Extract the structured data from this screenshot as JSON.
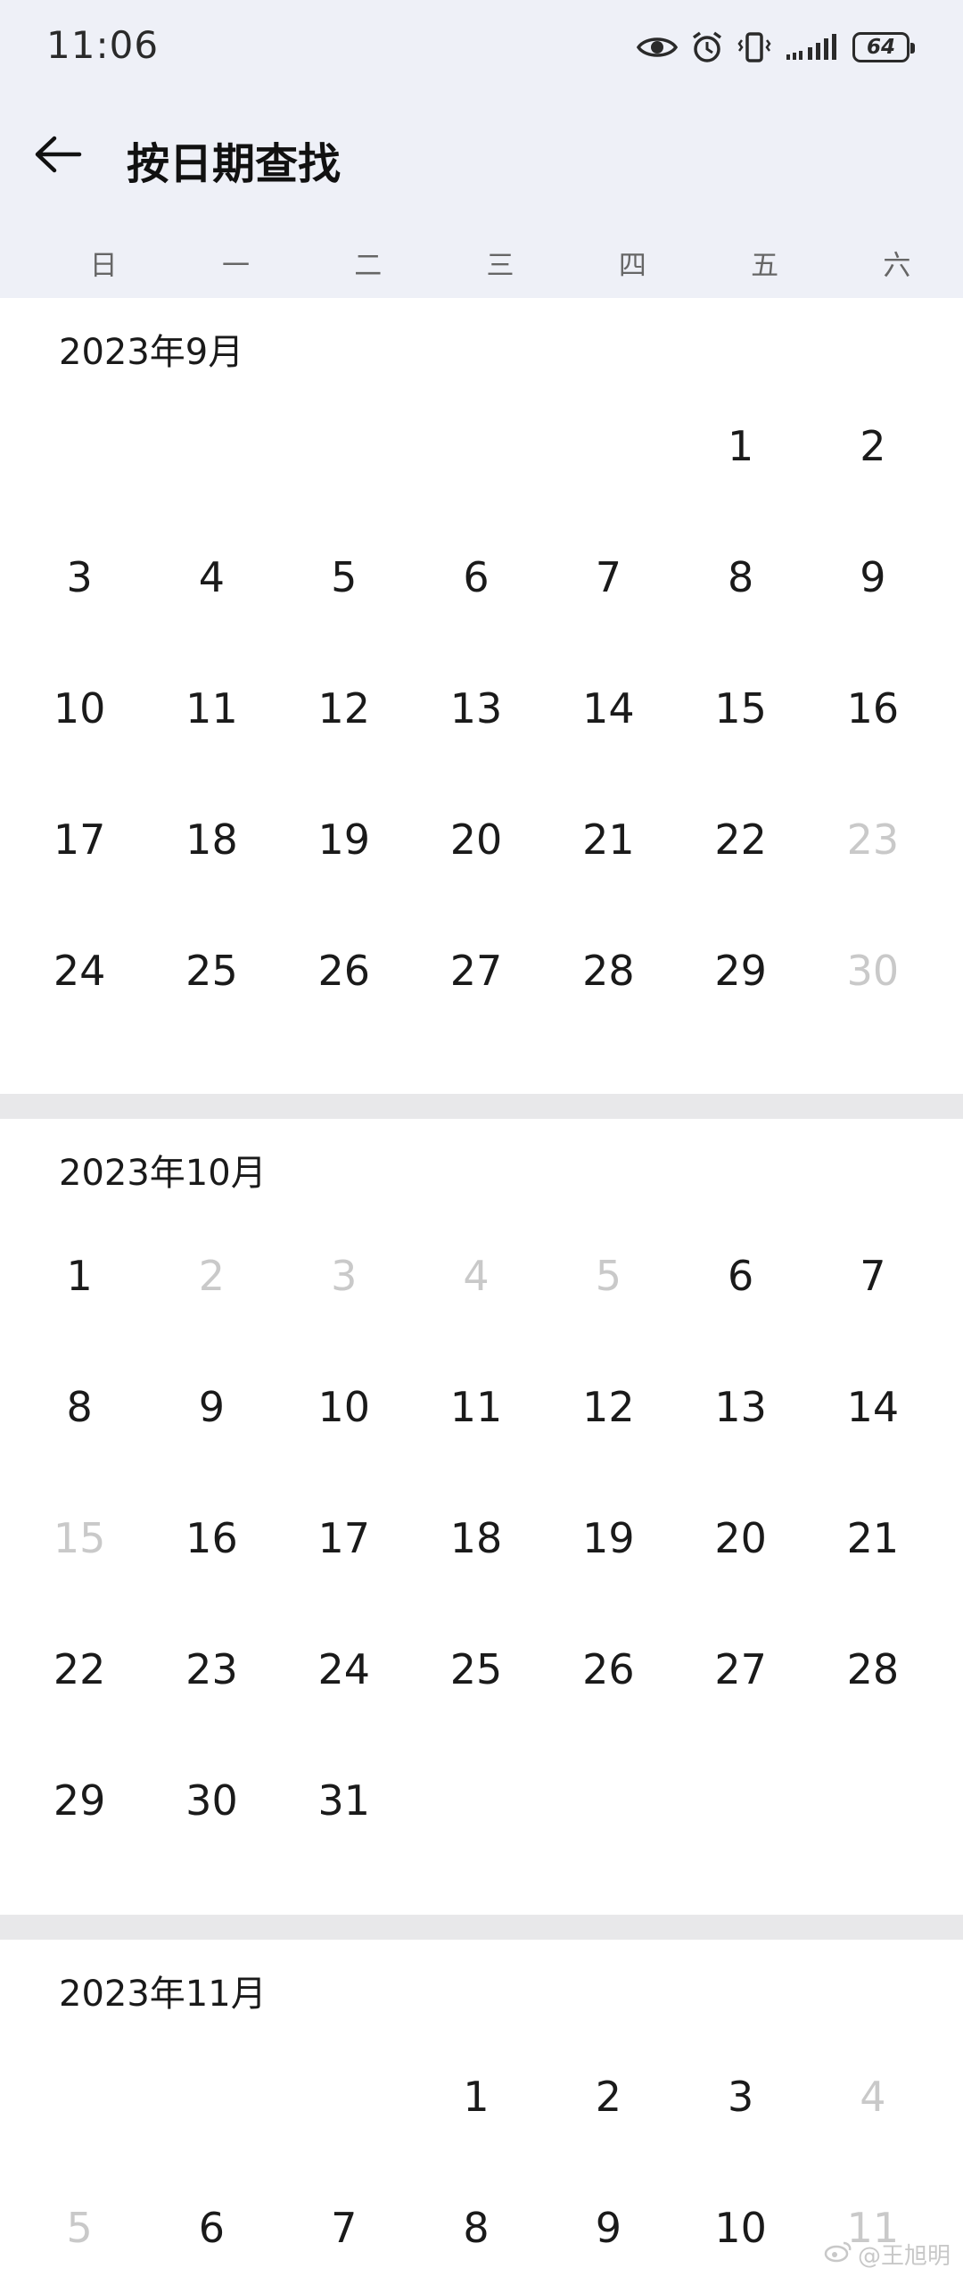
{
  "status_bar": {
    "time": "11:06",
    "battery": "64",
    "icons": [
      "eye-icon",
      "alarm-icon",
      "vibrate-icon",
      "signal-icon",
      "battery-icon"
    ]
  },
  "header": {
    "back_icon": "arrow-left-icon",
    "title": "按日期查找"
  },
  "weekdays": [
    "日",
    "一",
    "二",
    "三",
    "四",
    "五",
    "六"
  ],
  "months": [
    {
      "title": "2023年9月",
      "days": [
        {
          "d": "",
          "dis": false
        },
        {
          "d": "",
          "dis": false
        },
        {
          "d": "",
          "dis": false
        },
        {
          "d": "",
          "dis": false
        },
        {
          "d": "",
          "dis": false
        },
        {
          "d": "1",
          "dis": false
        },
        {
          "d": "2",
          "dis": false
        },
        {
          "d": "3",
          "dis": false
        },
        {
          "d": "4",
          "dis": false
        },
        {
          "d": "5",
          "dis": false
        },
        {
          "d": "6",
          "dis": false
        },
        {
          "d": "7",
          "dis": false
        },
        {
          "d": "8",
          "dis": false
        },
        {
          "d": "9",
          "dis": false
        },
        {
          "d": "10",
          "dis": false
        },
        {
          "d": "11",
          "dis": false
        },
        {
          "d": "12",
          "dis": false
        },
        {
          "d": "13",
          "dis": false
        },
        {
          "d": "14",
          "dis": false
        },
        {
          "d": "15",
          "dis": false
        },
        {
          "d": "16",
          "dis": false
        },
        {
          "d": "17",
          "dis": false
        },
        {
          "d": "18",
          "dis": false
        },
        {
          "d": "19",
          "dis": false
        },
        {
          "d": "20",
          "dis": false
        },
        {
          "d": "21",
          "dis": false
        },
        {
          "d": "22",
          "dis": false
        },
        {
          "d": "23",
          "dis": true
        },
        {
          "d": "24",
          "dis": false
        },
        {
          "d": "25",
          "dis": false
        },
        {
          "d": "26",
          "dis": false
        },
        {
          "d": "27",
          "dis": false
        },
        {
          "d": "28",
          "dis": false
        },
        {
          "d": "29",
          "dis": false
        },
        {
          "d": "30",
          "dis": true
        }
      ]
    },
    {
      "title": "2023年10月",
      "days": [
        {
          "d": "1",
          "dis": false
        },
        {
          "d": "2",
          "dis": true
        },
        {
          "d": "3",
          "dis": true
        },
        {
          "d": "4",
          "dis": true
        },
        {
          "d": "5",
          "dis": true
        },
        {
          "d": "6",
          "dis": false
        },
        {
          "d": "7",
          "dis": false
        },
        {
          "d": "8",
          "dis": false
        },
        {
          "d": "9",
          "dis": false
        },
        {
          "d": "10",
          "dis": false
        },
        {
          "d": "11",
          "dis": false
        },
        {
          "d": "12",
          "dis": false
        },
        {
          "d": "13",
          "dis": false
        },
        {
          "d": "14",
          "dis": false
        },
        {
          "d": "15",
          "dis": true
        },
        {
          "d": "16",
          "dis": false
        },
        {
          "d": "17",
          "dis": false
        },
        {
          "d": "18",
          "dis": false
        },
        {
          "d": "19",
          "dis": false
        },
        {
          "d": "20",
          "dis": false
        },
        {
          "d": "21",
          "dis": false
        },
        {
          "d": "22",
          "dis": false
        },
        {
          "d": "23",
          "dis": false
        },
        {
          "d": "24",
          "dis": false
        },
        {
          "d": "25",
          "dis": false
        },
        {
          "d": "26",
          "dis": false
        },
        {
          "d": "27",
          "dis": false
        },
        {
          "d": "28",
          "dis": false
        },
        {
          "d": "29",
          "dis": false
        },
        {
          "d": "30",
          "dis": false
        },
        {
          "d": "31",
          "dis": false
        }
      ]
    },
    {
      "title": "2023年11月",
      "days": [
        {
          "d": "",
          "dis": false
        },
        {
          "d": "",
          "dis": false
        },
        {
          "d": "",
          "dis": false
        },
        {
          "d": "1",
          "dis": false
        },
        {
          "d": "2",
          "dis": false
        },
        {
          "d": "3",
          "dis": false
        },
        {
          "d": "4",
          "dis": true
        },
        {
          "d": "5",
          "dis": true
        },
        {
          "d": "6",
          "dis": false
        },
        {
          "d": "7",
          "dis": false
        },
        {
          "d": "8",
          "dis": false
        },
        {
          "d": "9",
          "dis": false
        },
        {
          "d": "10",
          "dis": false
        },
        {
          "d": "11",
          "dis": true
        }
      ]
    }
  ],
  "watermark": "@王旭明"
}
